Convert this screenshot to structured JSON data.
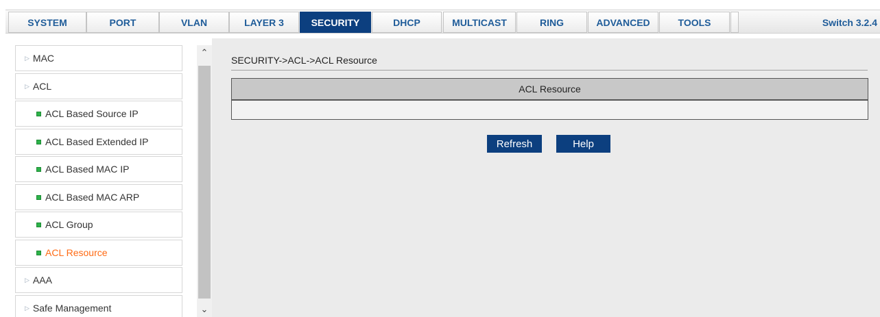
{
  "nav": {
    "tabs": [
      {
        "label": "SYSTEM",
        "active": false
      },
      {
        "label": "PORT",
        "active": false
      },
      {
        "label": "VLAN",
        "active": false
      },
      {
        "label": "LAYER 3",
        "active": false
      },
      {
        "label": "SECURITY",
        "active": true
      },
      {
        "label": "DHCP",
        "active": false
      },
      {
        "label": "MULTICAST",
        "active": false
      },
      {
        "label": "RING",
        "active": false
      },
      {
        "label": "ADVANCED",
        "active": false
      },
      {
        "label": "TOOLS",
        "active": false
      }
    ],
    "version": "Switch 3.2.4"
  },
  "sidebar": {
    "items": [
      {
        "label": "MAC",
        "level": "top",
        "icon": "triangle-right-icon"
      },
      {
        "label": "ACL",
        "level": "top",
        "icon": "triangle-right-icon"
      },
      {
        "label": "ACL Based Source IP",
        "level": "sub",
        "icon": "green-square-bullet-icon"
      },
      {
        "label": "ACL Based Extended IP",
        "level": "sub",
        "icon": "green-square-bullet-icon"
      },
      {
        "label": "ACL Based MAC IP",
        "level": "sub",
        "icon": "green-square-bullet-icon"
      },
      {
        "label": "ACL Based MAC ARP",
        "level": "sub",
        "icon": "green-square-bullet-icon"
      },
      {
        "label": "ACL Group",
        "level": "sub",
        "icon": "green-square-bullet-icon"
      },
      {
        "label": "ACL Resource",
        "level": "sub",
        "icon": "green-square-bullet-icon",
        "active": true
      },
      {
        "label": "AAA",
        "level": "top",
        "icon": "triangle-right-icon"
      },
      {
        "label": "Safe Management",
        "level": "top",
        "icon": "triangle-right-icon"
      }
    ]
  },
  "main": {
    "breadcrumb": "SECURITY->ACL->ACL Resource",
    "table": {
      "header": "ACL Resource"
    },
    "buttons": {
      "refresh": "Refresh",
      "help": "Help"
    }
  },
  "colors": {
    "accent": "#0c3f7f",
    "tab_text": "#1f5c99",
    "active_menu_text": "#ff6a13",
    "bullet_green": "#2db34a",
    "content_bg": "#ebebeb"
  }
}
